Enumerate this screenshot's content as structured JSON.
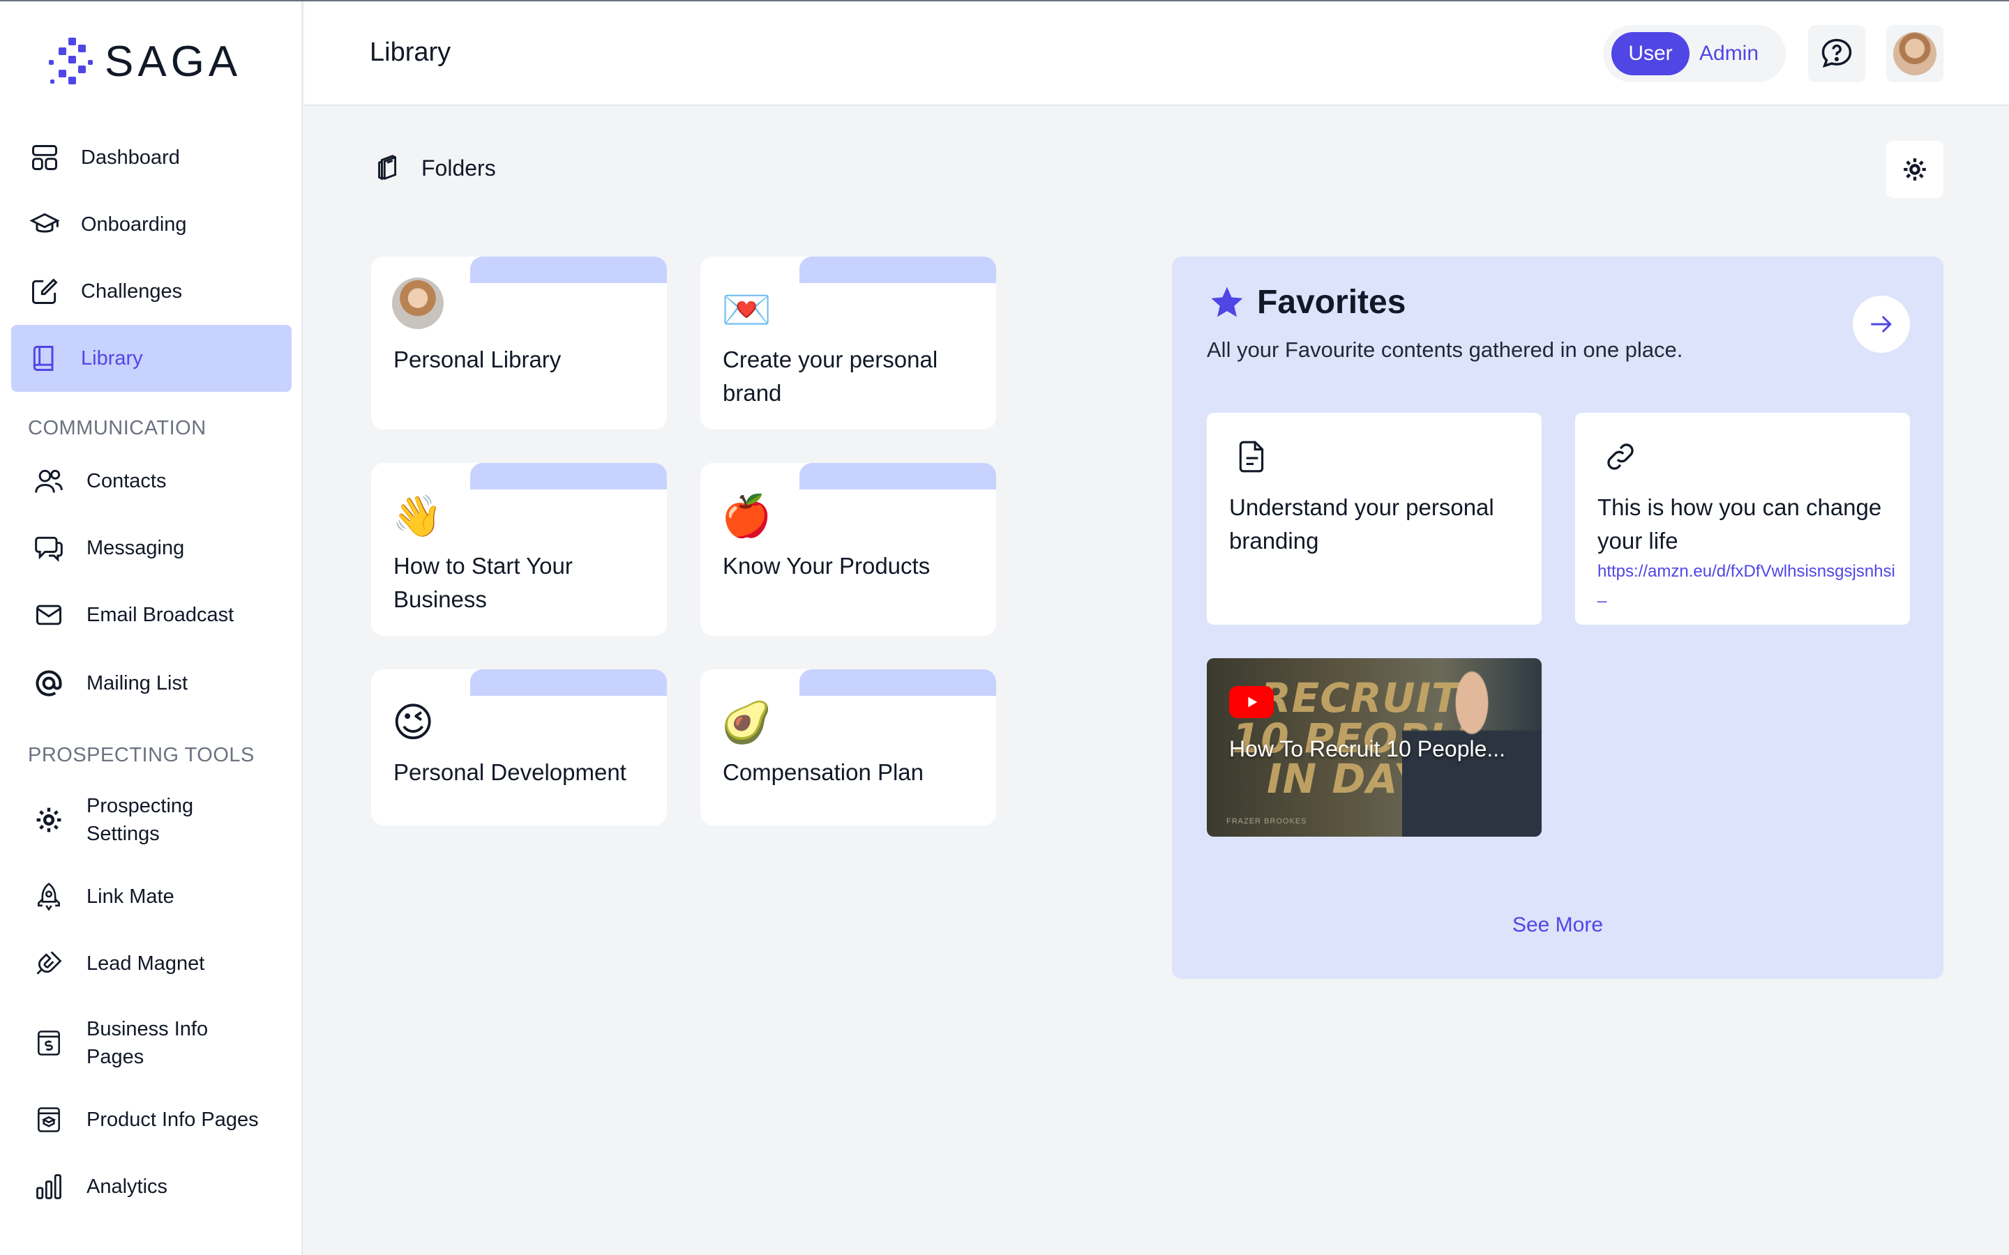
{
  "app": {
    "name": "SAGA"
  },
  "header": {
    "title": "Library",
    "role_user": "User",
    "role_admin": "Admin"
  },
  "sidebar": {
    "main_items": [
      {
        "label": "Dashboard",
        "icon": "dashboard-icon"
      },
      {
        "label": "Onboarding",
        "icon": "graduation-cap-icon"
      },
      {
        "label": "Challenges",
        "icon": "edit-square-icon"
      },
      {
        "label": "Library",
        "icon": "book-icon",
        "active": true
      }
    ],
    "communication_label": "COMMUNICATION",
    "communication_items": [
      {
        "label": "Contacts",
        "icon": "users-icon"
      },
      {
        "label": "Messaging",
        "icon": "chat-bubbles-icon"
      },
      {
        "label": "Email Broadcast",
        "icon": "envelope-icon"
      },
      {
        "label": "Mailing List",
        "icon": "at-sign-icon"
      }
    ],
    "prospecting_label": "PROSPECTING TOOLS",
    "prospecting_items": [
      {
        "label_line1": "Prospecting",
        "label_line2": "Settings",
        "icon": "gear-icon"
      },
      {
        "label": "Link Mate",
        "icon": "rocket-icon"
      },
      {
        "label": "Lead Magnet",
        "icon": "magnet-icon"
      },
      {
        "label_line1": "Business Info",
        "label_line2": "Pages",
        "icon": "dollar-page-icon"
      },
      {
        "label": "Product Info Pages",
        "icon": "product-page-icon"
      },
      {
        "label": "Analytics",
        "icon": "bar-chart-icon"
      }
    ]
  },
  "folders": {
    "heading": "Folders",
    "items": [
      {
        "title": "Personal Library",
        "emoji": ""
      },
      {
        "title": "Create your personal brand",
        "emoji": "💌"
      },
      {
        "title": "How to Start Your Business",
        "emoji": "👋"
      },
      {
        "title": "Know Your Products",
        "emoji": "🍎"
      },
      {
        "title": "Personal Development",
        "emoji": "😉"
      },
      {
        "title": "Compensation Plan",
        "emoji": "🥑"
      }
    ]
  },
  "favorites": {
    "title": "Favorites",
    "subtitle": "All your Favourite contents gathered in one place.",
    "cards": [
      {
        "title": "Understand your personal branding",
        "icon": "document-icon"
      },
      {
        "title": "This is how you can change your life",
        "icon": "link-icon",
        "link": "https://amzn.eu/d/fxDfVwlhsisnsgsjsnhsi_"
      }
    ],
    "video": {
      "title": "How To Recruit 10 People...",
      "thumb_text_line1": "RECRUIT",
      "thumb_text_line2": "10 PEOPLE",
      "thumb_text_line3": "IN DAYS",
      "credit": "FRAZER BROOKES"
    },
    "see_more": "See More"
  },
  "colors": {
    "accent": "#4f46e5",
    "accent_light": "#c7d2fe",
    "panel": "#dde3fb"
  }
}
